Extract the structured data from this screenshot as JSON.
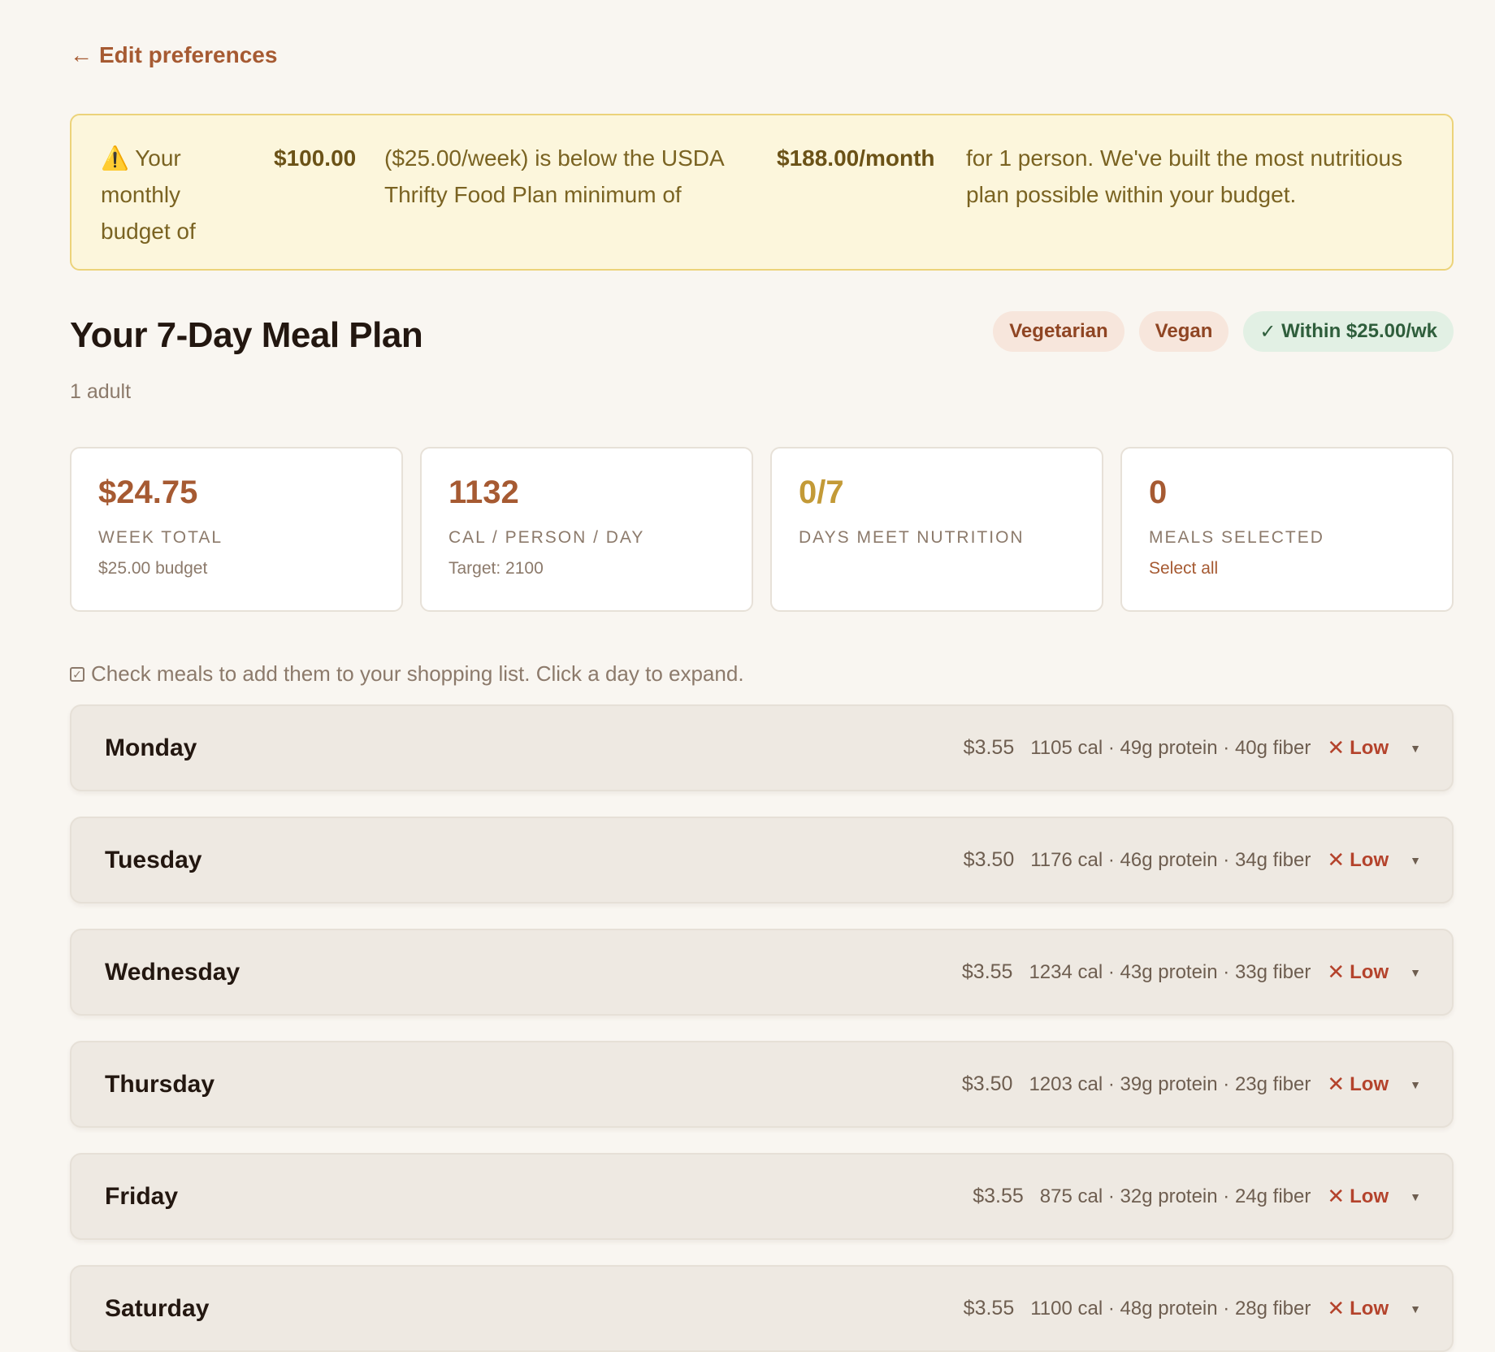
{
  "nav": {
    "back_label": "Edit preferences"
  },
  "warning": {
    "icon": "warning-icon",
    "part1": "Your monthly budget of",
    "monthly_budget": "$100.00",
    "part2": "($25.00/week) is below the USDA Thrifty Food Plan minimum of",
    "usda_minimum": "$188.00/month",
    "part3": "for 1 person. We've built the most nutritious plan possible within your budget."
  },
  "header": {
    "title": "Your 7-Day Meal Plan",
    "subtitle": "1 adult",
    "badges": {
      "diet1": "Vegetarian",
      "diet2": "Vegan",
      "budget": "Within $25.00/wk"
    }
  },
  "stats": [
    {
      "value": "$24.75",
      "label": "WEEK TOTAL",
      "sub": "$25.00 budget"
    },
    {
      "value": "1132",
      "label": "CAL / PERSON / DAY",
      "sub": "Target: 2100"
    },
    {
      "value": "0/7",
      "label": "DAYS MEET NUTRITION",
      "sub": ""
    },
    {
      "value": "0",
      "label": "MEALS SELECTED",
      "sub": "Select all"
    }
  ],
  "hint": "Check meals to add them to your shopping list. Click a day to expand.",
  "days": [
    {
      "name": "Monday",
      "cost": "$3.55",
      "nutrition": "1105 cal · 49g protein · 40g fiber",
      "status": "Low"
    },
    {
      "name": "Tuesday",
      "cost": "$3.50",
      "nutrition": "1176 cal · 46g protein · 34g fiber",
      "status": "Low"
    },
    {
      "name": "Wednesday",
      "cost": "$3.55",
      "nutrition": "1234 cal · 43g protein · 33g fiber",
      "status": "Low"
    },
    {
      "name": "Thursday",
      "cost": "$3.50",
      "nutrition": "1203 cal · 39g protein · 23g fiber",
      "status": "Low"
    },
    {
      "name": "Friday",
      "cost": "$3.55",
      "nutrition": "875 cal · 32g protein · 24g fiber",
      "status": "Low"
    },
    {
      "name": "Saturday",
      "cost": "$3.55",
      "nutrition": "1100 cal · 48g protein · 28g fiber",
      "status": "Low"
    }
  ],
  "colors": {
    "accent": "#a65a32",
    "gold": "#c39a37",
    "warning_bg": "#fcf6dc",
    "low": "#b4432c"
  }
}
